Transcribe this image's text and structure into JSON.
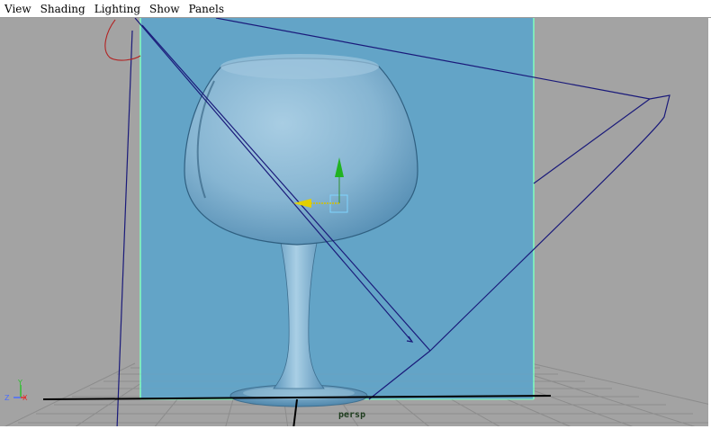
{
  "menubar": {
    "items": [
      "View",
      "Shading",
      "Lighting",
      "Show",
      "Panels"
    ]
  },
  "viewport": {
    "camera_label": "persp",
    "background_color": "#a3a3a3",
    "plane_color": "#63a4c7",
    "plane_edge_color": "#7fffbf",
    "glass_color": "#8dbbd8",
    "wire_color": "#1a1a7a",
    "grid_color": "#8c8c8c"
  },
  "axis_indicator": {
    "y_label": "Y",
    "z_label": "Z",
    "x_label": "X"
  }
}
